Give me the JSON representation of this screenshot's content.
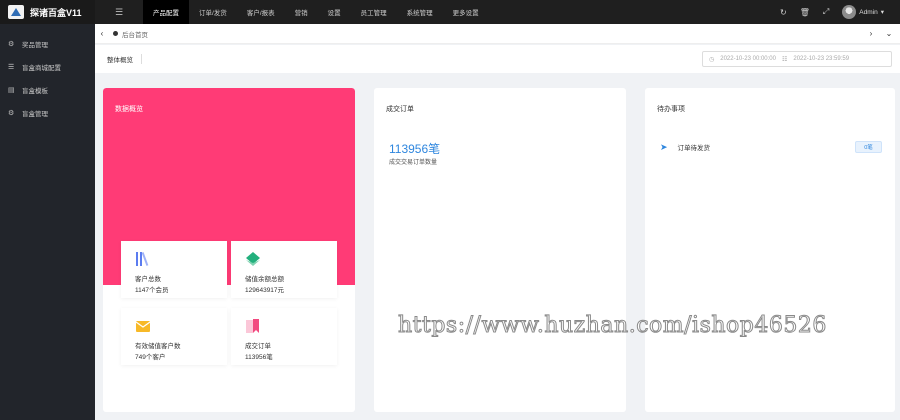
{
  "app": {
    "title": "探诸百盒V11"
  },
  "topnav": {
    "items": [
      "产品配置",
      "订单/发货",
      "客户/报表",
      "营销",
      "设置",
      "员工管理",
      "系统管理",
      "更多设置"
    ]
  },
  "user": {
    "name": "Admin"
  },
  "sidebar": {
    "items": [
      {
        "label": "奖品管理",
        "icon": "gear-icon"
      },
      {
        "label": "盲盒商城配置",
        "icon": "list-icon"
      },
      {
        "label": "盲盒模板",
        "icon": "grid-icon"
      },
      {
        "label": "盲盒管理",
        "icon": "settings-icon"
      }
    ]
  },
  "tabs": {
    "home": "后台首页"
  },
  "filter": {
    "overview": "整体概览",
    "date_start": "2022-10-23 00:00:00",
    "date_end": "2022-10-23 23:59:59"
  },
  "cards": {
    "data_overview": {
      "title": "数据概览"
    },
    "stats": [
      {
        "label": "客户总数",
        "value": "1147个会员",
        "icon": "books-icon",
        "color": "#5b7cf0"
      },
      {
        "label": "储值余额总额",
        "value": "129643917元",
        "icon": "diamond-icon",
        "color": "#23b07d"
      },
      {
        "label": "有效储值客户数",
        "value": "749个客户",
        "icon": "envelope-icon",
        "color": "#f7b928"
      },
      {
        "label": "成交订单",
        "value": "113956笔",
        "icon": "bookmark-icon",
        "color": "#f2497f"
      }
    ],
    "deal": {
      "title": "成交订单",
      "value": "113956笔",
      "sub": "成交交易订单数量"
    },
    "todo": {
      "title": "待办事项",
      "item_label": "订单待发货",
      "button": "0笔"
    }
  },
  "watermark": "https://www.huzhan.com/ishop46526",
  "colors": {
    "accent": "#2e86de",
    "pink": "#ff3b76",
    "topbar": "#1f1f1f",
    "sidebar": "#22252b"
  }
}
